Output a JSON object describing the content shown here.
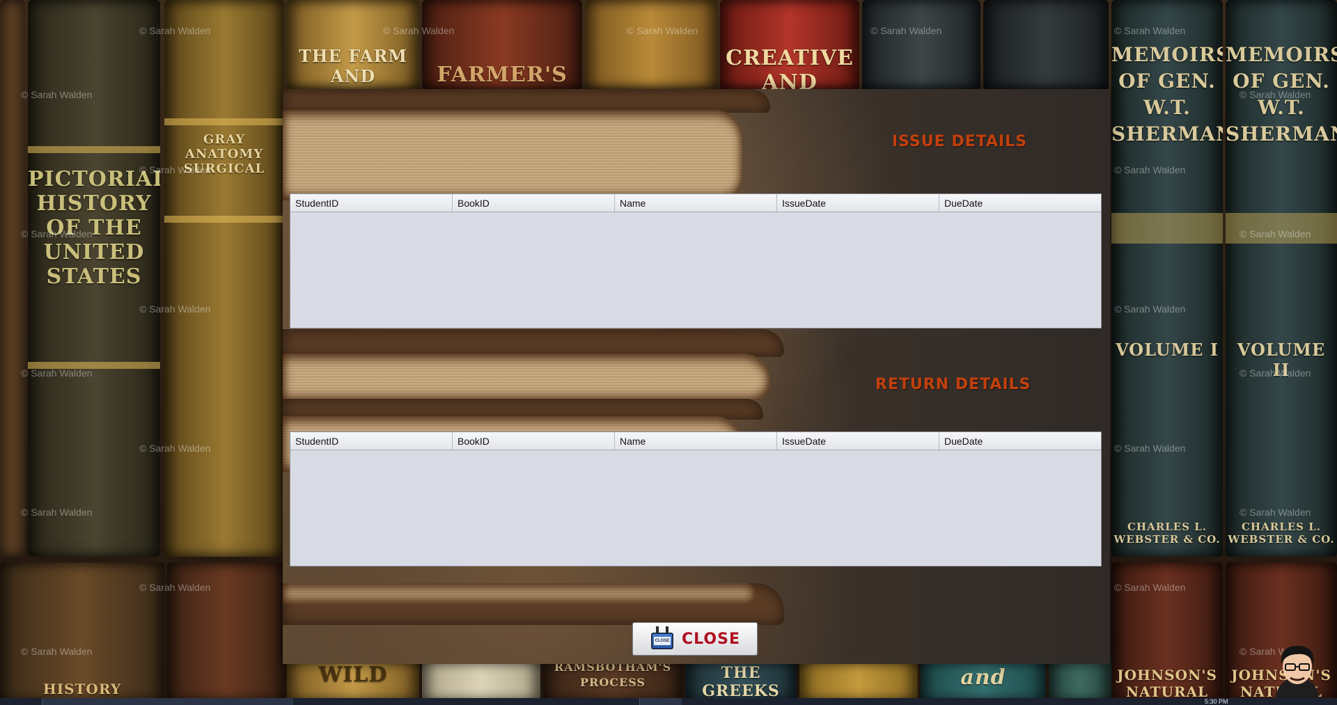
{
  "wallpaper": {
    "watermark": "© Sarah Walden",
    "spines": [
      {
        "text": "THE FARM AND",
        "color": "#b58a3a"
      },
      {
        "text": "FARMER'S",
        "color": "#7a2f1e"
      },
      {
        "text": "CREATIVE AND",
        "color": "#a12a1c"
      },
      {
        "text": "PICTORIAL HISTORY OF THE UNITED STATES",
        "color": "#3d3a2a"
      },
      {
        "text": "GRAY ANATOMY SURGICAL",
        "color": "#8a6a2a"
      },
      {
        "text": "MEMOIRS OF GEN. W.T. SHERMAN",
        "color": "#2f3b3a"
      },
      {
        "text": "VOLUME I",
        "color": "#2f3b3a"
      },
      {
        "text": "VOLUME II",
        "color": "#2f3b3a"
      },
      {
        "text": "CHARLES L. WEBSTER & CO.",
        "color": "#2f3b3a"
      },
      {
        "text": "WILD",
        "color": "#9b7a2e"
      },
      {
        "text": "RAMSBOTHAM'S PROCESS",
        "color": "#5a3b22"
      },
      {
        "text": "THE GREEKS AND",
        "color": "#2d4a55"
      },
      {
        "text": "and",
        "color": "#2d5a5a"
      },
      {
        "text": "JOHNSON'S NATURAL",
        "color": "#5a2a18"
      },
      {
        "text": "HISTORY",
        "color": "#4a2a18"
      }
    ]
  },
  "dialog": {
    "issue_section": {
      "title": "ISSUE DETAILS",
      "columns": [
        "StudentID",
        "BookID",
        "Name",
        "IssueDate",
        "DueDate"
      ],
      "rows": []
    },
    "return_section": {
      "title": "RETURN DETAILS",
      "columns": [
        "StudentID",
        "BookID",
        "Name",
        "IssueDate",
        "DueDate"
      ],
      "rows": []
    },
    "close_button": {
      "label": "CLOSE",
      "icon": "close-sign-icon",
      "icon_text": "CLOSE"
    }
  },
  "taskbar": {
    "clock_text": "5:30 PM"
  },
  "colors": {
    "section_title": "#c2400d",
    "close_label": "#b01020",
    "table_body": "#d8dbe3"
  }
}
